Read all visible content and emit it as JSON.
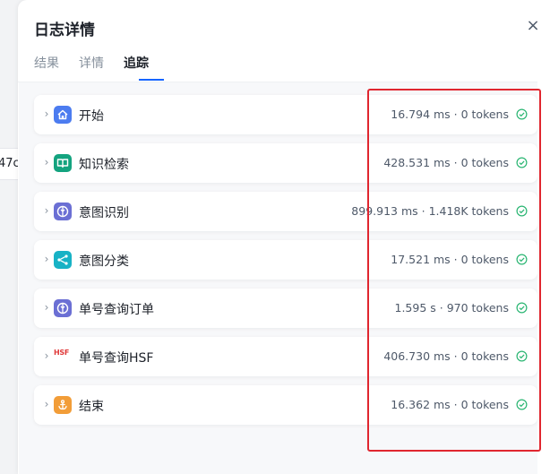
{
  "background": {
    "fragment_text": "47c"
  },
  "header": {
    "title": "日志详情",
    "close_label": "×"
  },
  "tabs": [
    {
      "label": "结果",
      "active": false
    },
    {
      "label": "详情",
      "active": false
    },
    {
      "label": "追踪",
      "active": true
    }
  ],
  "nodes": [
    {
      "name": "开始",
      "metric": "16.794 ms · 0 tokens",
      "icon": "home-icon",
      "color": "#4c7cf0"
    },
    {
      "name": "知识检索",
      "metric": "428.531 ms · 0 tokens",
      "icon": "book-icon",
      "color": "#14a37f"
    },
    {
      "name": "意图识别",
      "metric": "899.913 ms · 1.418K tokens",
      "icon": "model-icon",
      "color": "#6b6fd4"
    },
    {
      "name": "意图分类",
      "metric": "17.521 ms · 0 tokens",
      "icon": "branch-icon",
      "color": "#18b2c5"
    },
    {
      "name": "单号查询订单",
      "metric": "1.595 s · 970 tokens",
      "icon": "model-icon",
      "color": "#6b6fd4"
    },
    {
      "name": "单号查询HSF",
      "metric": "406.730 ms · 0 tokens",
      "icon": "hsf-logo",
      "icon_text": "HSF",
      "color": "#e03a3a"
    },
    {
      "name": "结束",
      "metric": "16.362 ms · 0 tokens",
      "icon": "anchor-icon",
      "color": "#f29d38"
    }
  ],
  "status_icon": "success-check-icon",
  "status_color": "#2bb673",
  "accent": "#1664ff",
  "highlight_color": "#e0262f"
}
